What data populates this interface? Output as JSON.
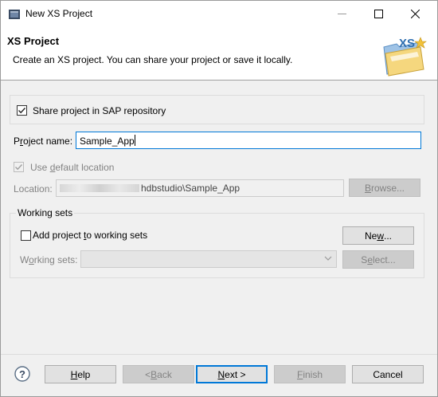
{
  "window": {
    "title": "New XS Project"
  },
  "header": {
    "title": "XS Project",
    "description": "Create an XS project. You can share your project or save it locally.",
    "icon_text": "XS"
  },
  "share": {
    "label": "Share project in SAP repository",
    "checked": true
  },
  "project_name": {
    "label_before": "P",
    "label_accel": "r",
    "label_after": "oject name:",
    "value": "Sample_App"
  },
  "default_location": {
    "label_before": "Use ",
    "label_accel": "d",
    "label_after": "efault location",
    "checked": true
  },
  "location": {
    "label": "Location:",
    "value_visible": "hdbstudio\\Sample_App",
    "browse_label_accel": "B",
    "browse_label_rest": "rowse..."
  },
  "working_sets": {
    "group_title": "Working sets",
    "add_label_before": "Add project ",
    "add_label_accel": "t",
    "add_label_after": "o working sets",
    "new_label_accel": "w",
    "new_label_before": "Ne",
    "new_label_after": "...",
    "sets_label_before": "W",
    "sets_label_accel": "o",
    "sets_label_after": "rking sets:",
    "select_label_accel": "e",
    "select_label_before": "S",
    "select_label_after": "lect..."
  },
  "footer": {
    "help_before": "",
    "help_accel": "H",
    "help_after": "elp",
    "back_before": "< ",
    "back_accel": "B",
    "back_after": "ack",
    "next_before": "",
    "next_accel": "N",
    "next_after": "ext >",
    "finish_before": "",
    "finish_accel": "F",
    "finish_after": "inish",
    "cancel": "Cancel"
  },
  "colors": {
    "accent": "#0078d7",
    "dialog_bg": "#f0f0f0",
    "disabled_text": "#838383"
  }
}
